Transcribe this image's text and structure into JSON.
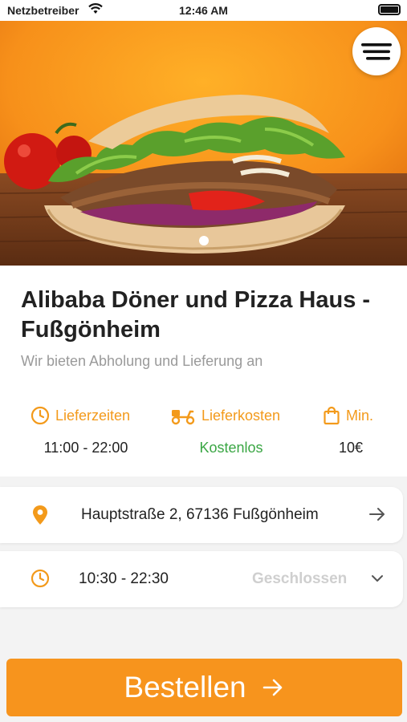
{
  "status_bar": {
    "carrier": "Netzbetreiber",
    "time": "12:46 AM"
  },
  "hero": {
    "page_index": 1,
    "page_count": 1
  },
  "restaurant": {
    "name": "Alibaba Döner und Pizza Haus - Fußgönheim",
    "subtitle": "Wir bieten Abholung und Lieferung an"
  },
  "info": [
    {
      "label": "Lieferzeiten",
      "value": "11:00 - 22:00",
      "icon": "clock-icon"
    },
    {
      "label": "Lieferkosten",
      "value": "Kostenlos",
      "icon": "scooter-icon"
    },
    {
      "label": "Min.",
      "value": "10€",
      "icon": "shopping-bag-icon"
    }
  ],
  "address": {
    "text": "Hauptstraße 2, 67136 Fußgönheim",
    "icon": "location-pin-icon"
  },
  "hours": {
    "text": "10:30 - 22:30",
    "status": "Geschlossen",
    "icon": "clock-icon"
  },
  "order_button": {
    "label": "Bestellen"
  },
  "colors": {
    "accent": "#f7941d",
    "green": "#3aa644",
    "muted": "#9a9a9a"
  }
}
